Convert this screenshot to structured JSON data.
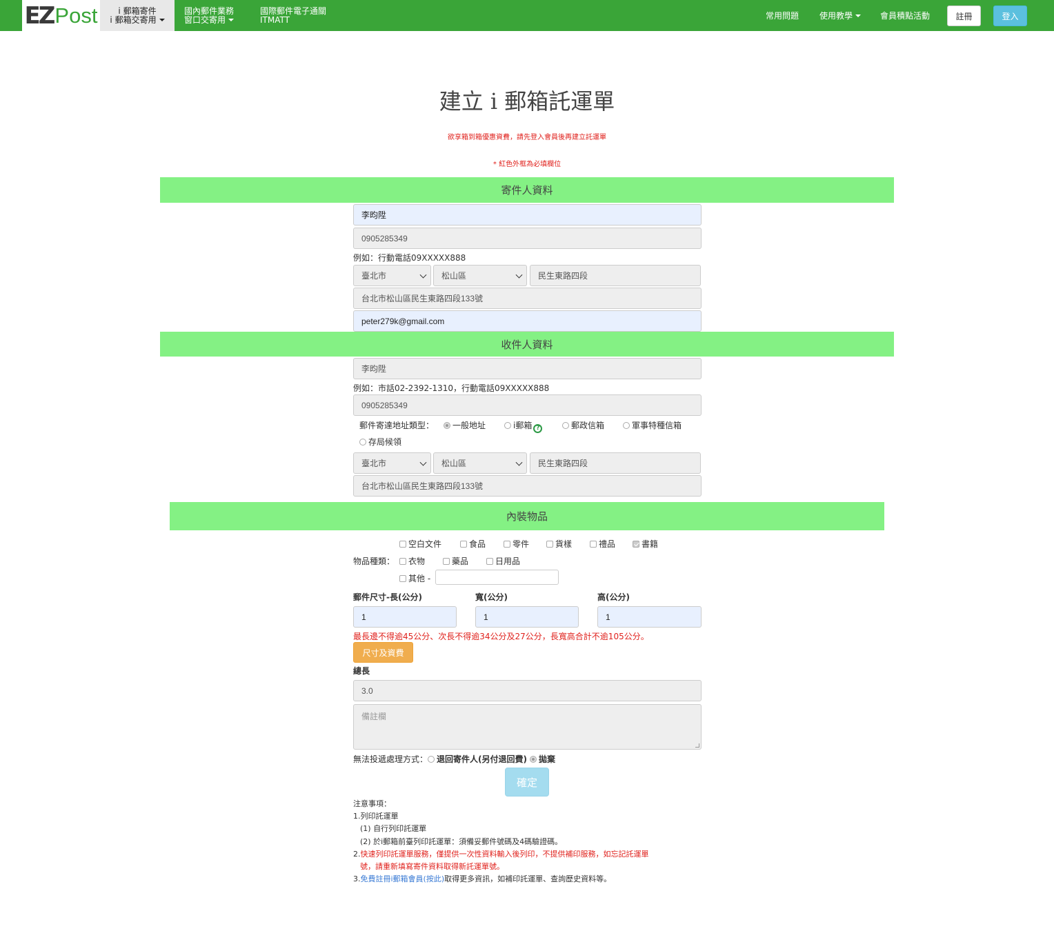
{
  "nav": {
    "logo_ez": "EZ",
    "logo_post": "Post",
    "item1_line1": "i 郵箱寄件",
    "item1_line2": "i 郵箱交寄用",
    "item2_line1": "國內郵件業務",
    "item2_line2": "窗口交寄用",
    "item3_line1": "國際郵件電子通關",
    "item3_line2": "ITMATT",
    "faq": "常用問題",
    "tutorial": "使用教學",
    "points": "會員積點活動",
    "register": "註冊",
    "login": "登入"
  },
  "header": {
    "title": "建立 i 郵箱託運單",
    "login_notice": "欲享箱到箱優惠資費，請先登入會員後再建立託運單",
    "required_notice": "* 紅色外框為必填欄位"
  },
  "sender": {
    "section_title": "寄件人資料",
    "name": "李昀陞",
    "phone": "0905285349",
    "phone_hint": "例如：行動電話09XXXXX888",
    "city": "臺北市",
    "district": "松山區",
    "road": "民生東路四段",
    "address": "台北市松山區民生東路四段133號",
    "email": "peter279k@gmail.com"
  },
  "receiver": {
    "section_title": "收件人資料",
    "name": "李昀陞",
    "phone_hint": "例如：市話02-2392-1310，行動電話09XXXXX888",
    "phone": "0905285349",
    "address_type_label": "郵件寄達地址類型：",
    "address_types": [
      "一般地址",
      "i郵箱",
      "郵政信箱",
      "軍事特種信箱",
      "存局候領"
    ],
    "city": "臺北市",
    "district": "松山區",
    "road": "民生東路四段",
    "address": "台北市松山區民生東路四段133號"
  },
  "contents": {
    "section_title": "內裝物品",
    "category_label": "物品種類：",
    "categories": [
      "空白文件",
      "食品",
      "零件",
      "貨樣",
      "禮品",
      "書籍",
      "衣物",
      "藥品",
      "日用品",
      "其他 -"
    ],
    "checked_category": "書籍",
    "size_length_label": "郵件尺寸-長(公分)",
    "size_width_label": "寬(公分)",
    "size_height_label": "高(公分)",
    "length": "1",
    "width": "1",
    "height": "1",
    "size_warning": "最長邊不得逾45公分、次長不得逾34公分及27公分，長寬高合計不逾105公分。",
    "size_fee_button": "尺寸及資費",
    "total_length_label": "總長",
    "total_length": "3.0",
    "remarks_placeholder": "備註欄",
    "undeliverable_label": "無法投遞處理方式：",
    "undeliverable_return": "退回寄件人(另付退回費)",
    "undeliverable_discard": "拋棄",
    "confirm_button": "確定"
  },
  "notes": {
    "title": "注意事項：",
    "n1": "1.列印託運單",
    "n1a": "(1) 自行列印託運單",
    "n1b": "(2) 於i郵箱前臺列印託運單：須備妥郵件號碼及4碼驗證碼。",
    "n2_prefix": "2.",
    "n2_line1": "快速列印託運單服務，僅提供一次性資料輸入後列印，不提供補印服務，如忘記託運單",
    "n2_line2": "號，請重新填寫寄件資料取得新託運單號。",
    "n3_prefix": "3.",
    "n3_link": "免費註冊i郵箱會員(按此)",
    "n3_rest": "取得更多資訊，如補印託運單、查詢歷史資料等。"
  }
}
